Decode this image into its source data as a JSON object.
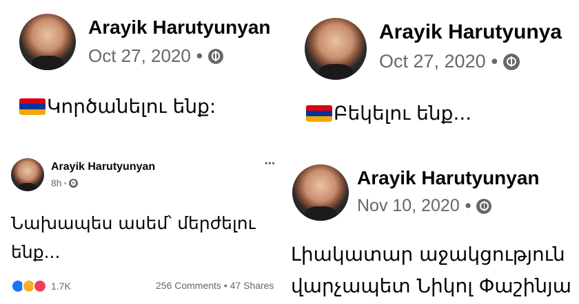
{
  "posts": [
    {
      "author": "Arayik Harutyunyan",
      "date": "Oct 27, 2020",
      "dot": "•",
      "text": "Կործանելու ենք:",
      "flag_colors": [
        "#D90012",
        "#0033A0",
        "#F2A800"
      ]
    },
    {
      "author": "Arayik Harutyunya",
      "date": "Oct 27, 2020",
      "dot": "•",
      "text": "Բեկելու ենք...",
      "flag_colors": [
        "#D90012",
        "#0033A0",
        "#F2A800"
      ]
    },
    {
      "author": "Arayik Harutyunyan",
      "date": "8h",
      "dot": "·",
      "more": "•••",
      "text_line1": "Նախապես ասեմ՝ մերժելու",
      "text_line2": "ենք...",
      "reaction_count": "1.7K",
      "comments_shares": "256 Comments • 47 Shares"
    },
    {
      "author": "Arayik Harutyunyan",
      "date": "Nov 10, 2020",
      "dot": "•",
      "text_line1": "Լիակատար աջակցություն",
      "text_line2": "վարչապետ Նիկոլ Փաշինյա"
    }
  ]
}
